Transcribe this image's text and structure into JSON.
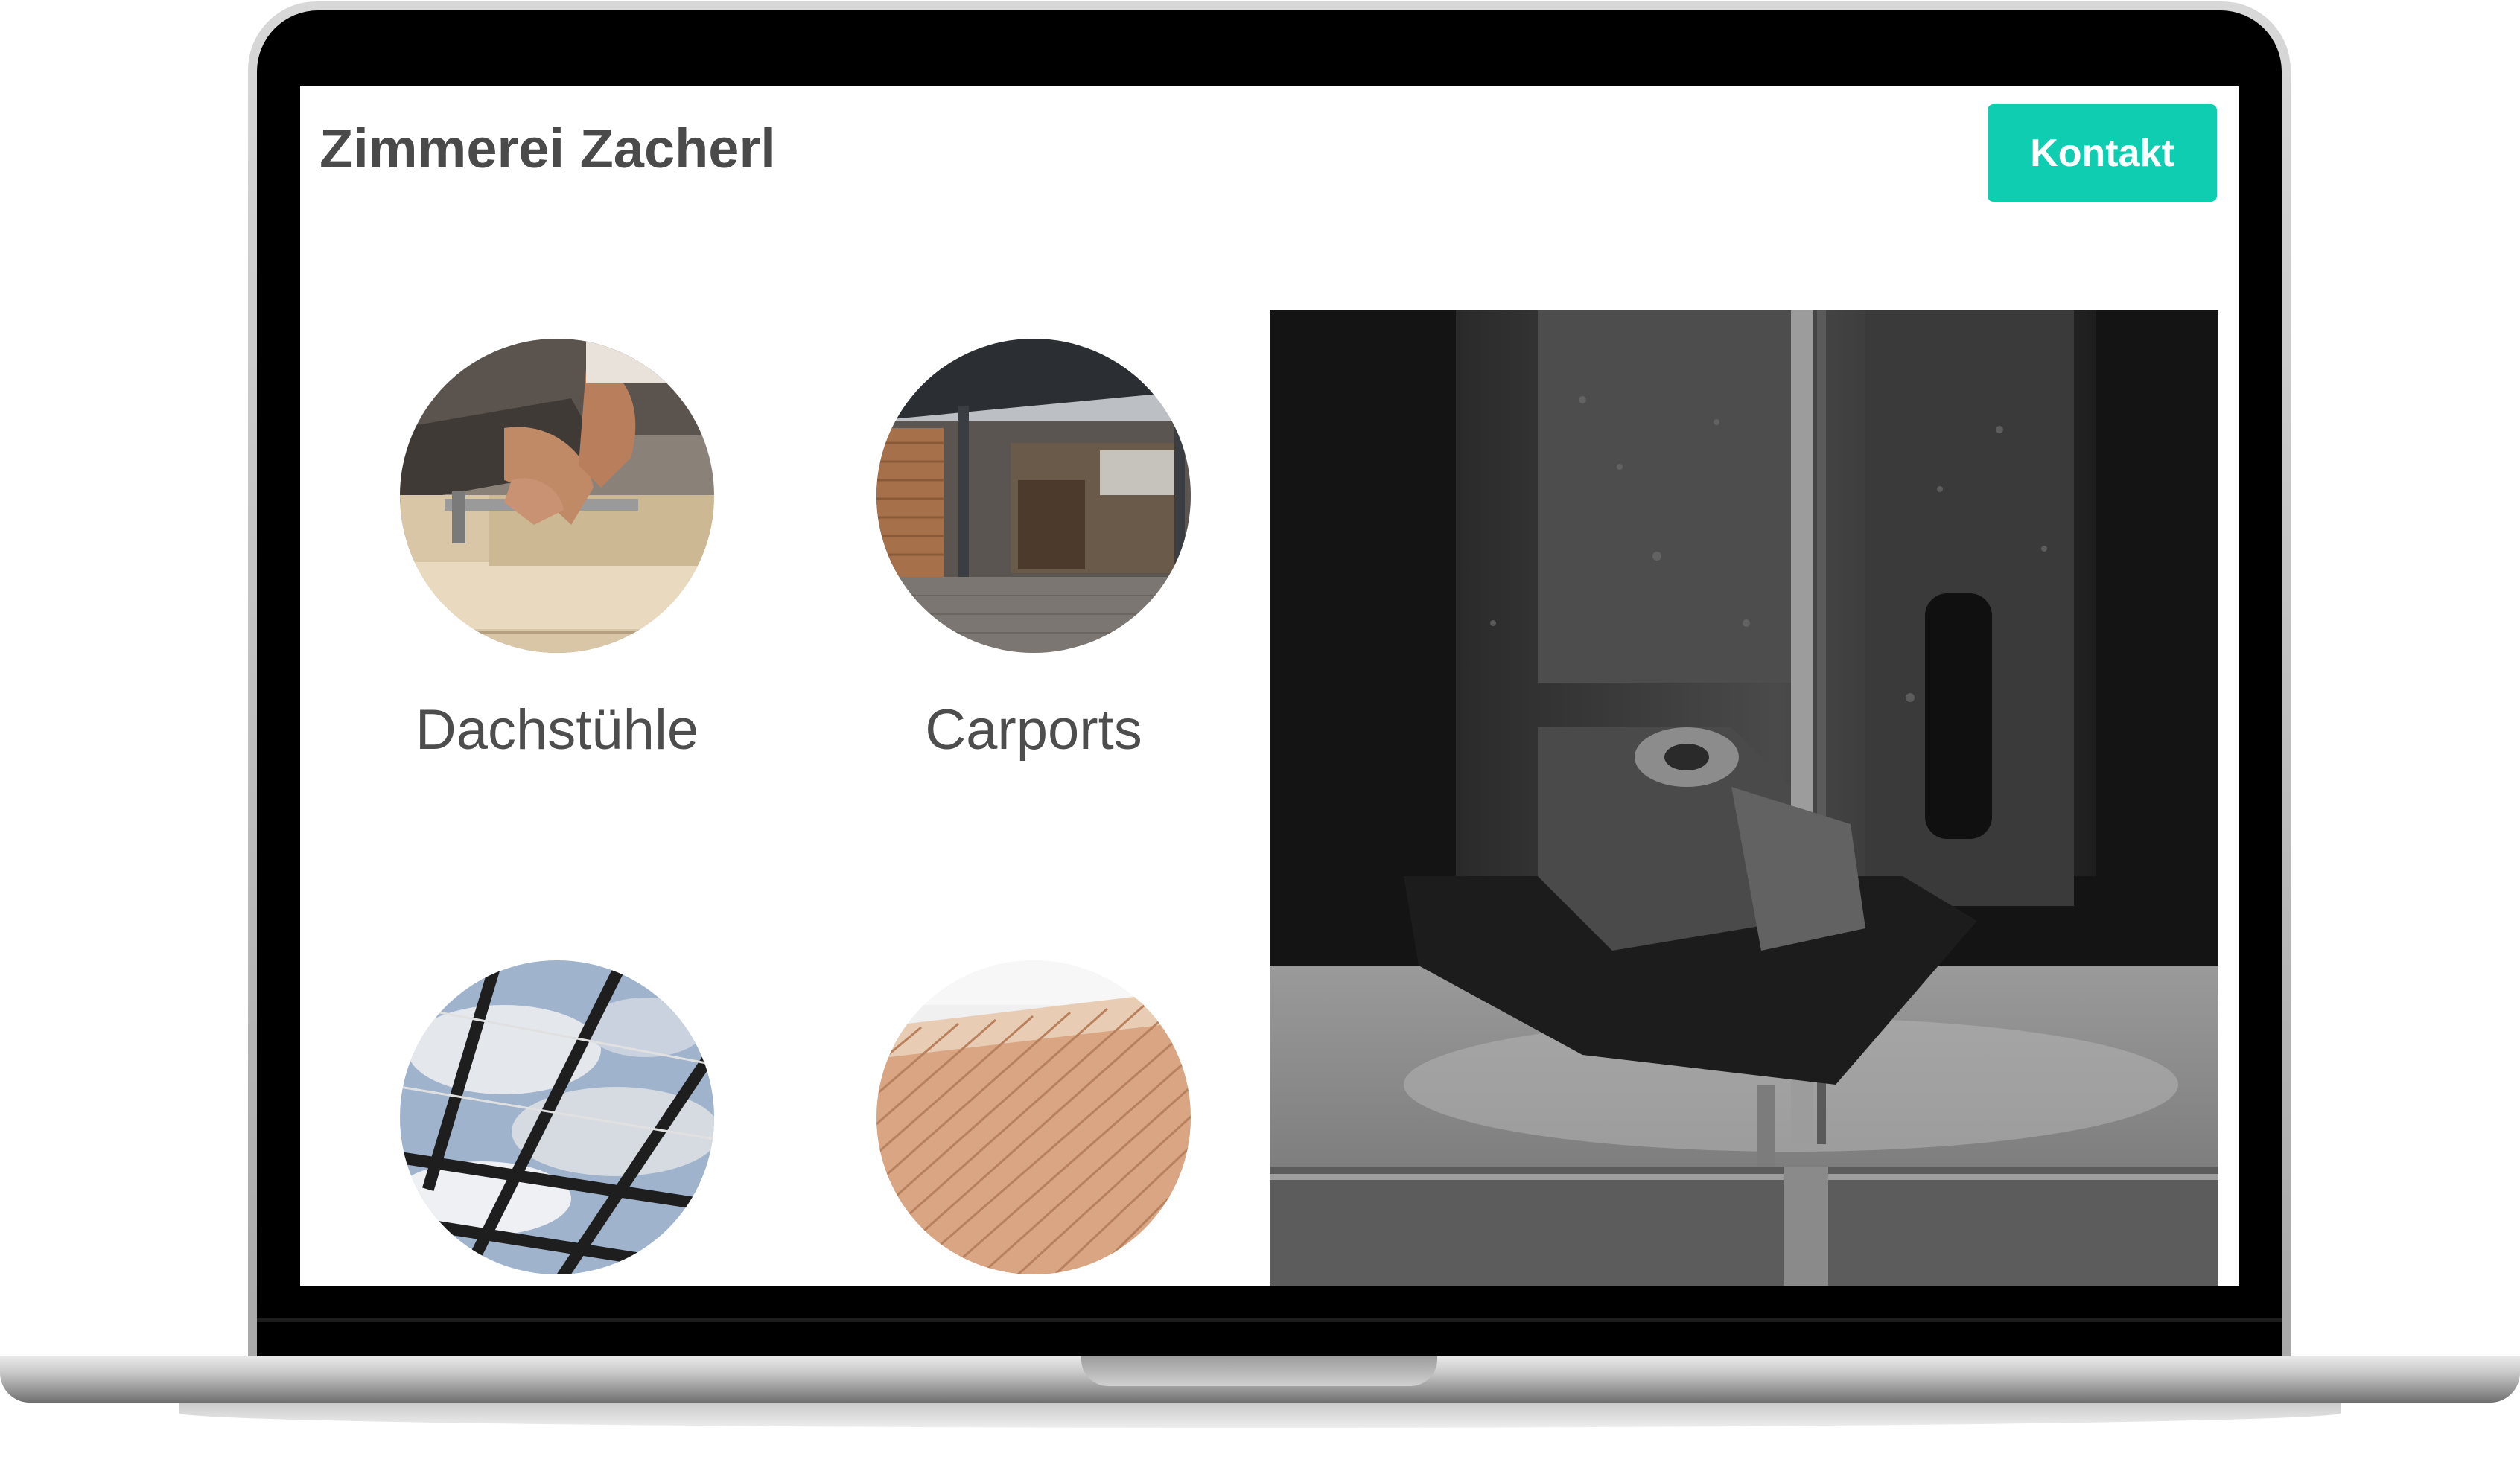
{
  "site": {
    "brand": "Zimmerei Zacherl",
    "contact_label": "Kontakt",
    "accent_color": "#0fcdb0"
  },
  "services": [
    {
      "label": "Dachstühle",
      "image": "roof-truss-photo"
    },
    {
      "label": "Carports",
      "image": "carport-photo"
    },
    {
      "label": "",
      "image": "glass-roof-photo"
    },
    {
      "label": "",
      "image": "wood-facade-photo"
    }
  ],
  "hero": {
    "image": "bandsaw-photo"
  }
}
